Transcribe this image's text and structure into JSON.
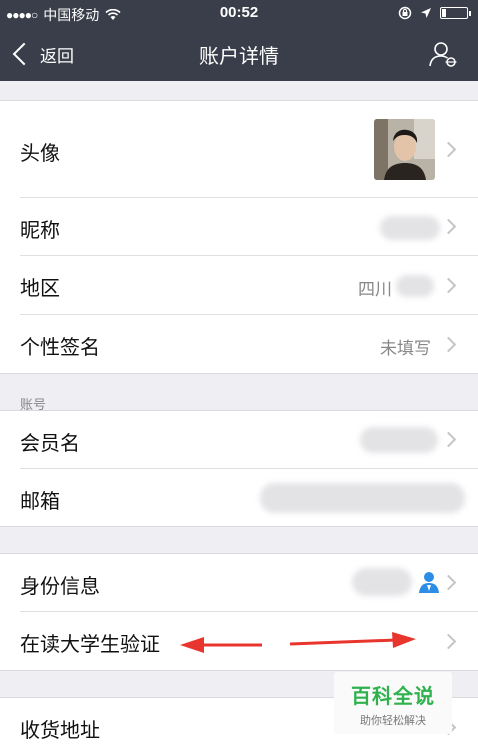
{
  "status_bar": {
    "signal_dots": "●●●●○",
    "carrier": "中国移动",
    "time": "00:52"
  },
  "nav": {
    "back_label": "返回",
    "title": "账户详情"
  },
  "rows": {
    "avatar": {
      "label": "头像"
    },
    "nickname": {
      "label": "昵称"
    },
    "region": {
      "label": "地区",
      "value": "四川"
    },
    "signature": {
      "label": "个性签名",
      "value": "未填写"
    },
    "account_section": "账号",
    "member_name": {
      "label": "会员名"
    },
    "email": {
      "label": "邮箱"
    },
    "identity": {
      "label": "身份信息"
    },
    "student_verify": {
      "label": "在读大学生验证"
    },
    "address": {
      "label": "收货地址"
    }
  },
  "watermark": {
    "title": "百科全说",
    "subtitle": "助你轻松解决"
  },
  "colors": {
    "header_bg": "#3a3e4a",
    "arrow_red": "#e8362f",
    "watermark_green": "#2fb24e",
    "identity_icon": "#2b8de6"
  }
}
